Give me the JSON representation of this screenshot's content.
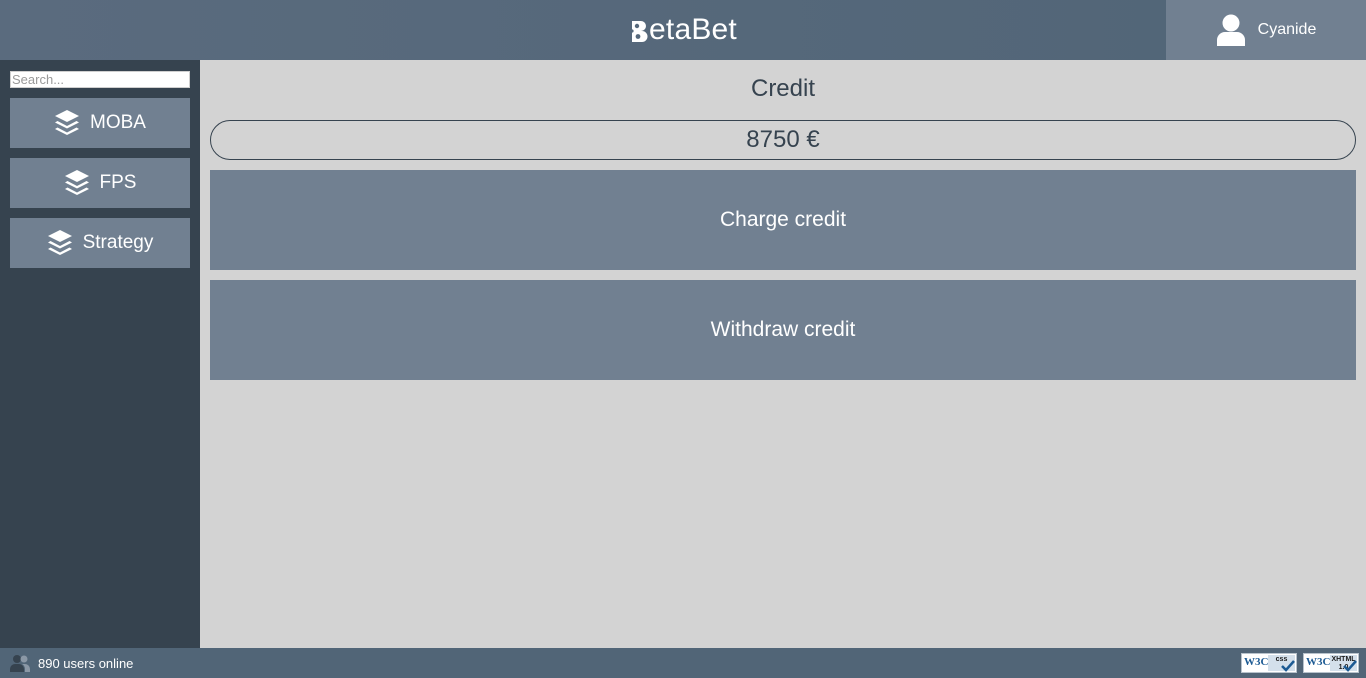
{
  "header": {
    "brand": "BetaBet",
    "brand_rest": "etaBet",
    "username": "Cyanide"
  },
  "sidebar": {
    "search_placeholder": "Search...",
    "categories": [
      {
        "label": "MOBA",
        "icon": "layers-icon"
      },
      {
        "label": "FPS",
        "icon": "layers-icon"
      },
      {
        "label": "Strategy",
        "icon": "layers-icon"
      }
    ]
  },
  "main": {
    "credit_title": "Credit",
    "credit_value": "8750 €",
    "charge_label": "Charge credit",
    "withdraw_label": "Withdraw credit"
  },
  "footer": {
    "online_text": "890 users online",
    "badges": [
      {
        "org": "W3C",
        "kind": "css"
      },
      {
        "org": "W3C",
        "kind": "XHTML 1.0"
      }
    ]
  },
  "colors": {
    "header": "#56697c",
    "sidebar": "#36434f",
    "button": "#718091",
    "main_bg": "#d3d3d3",
    "footer": "#516577",
    "text_dark": "#36434f"
  }
}
